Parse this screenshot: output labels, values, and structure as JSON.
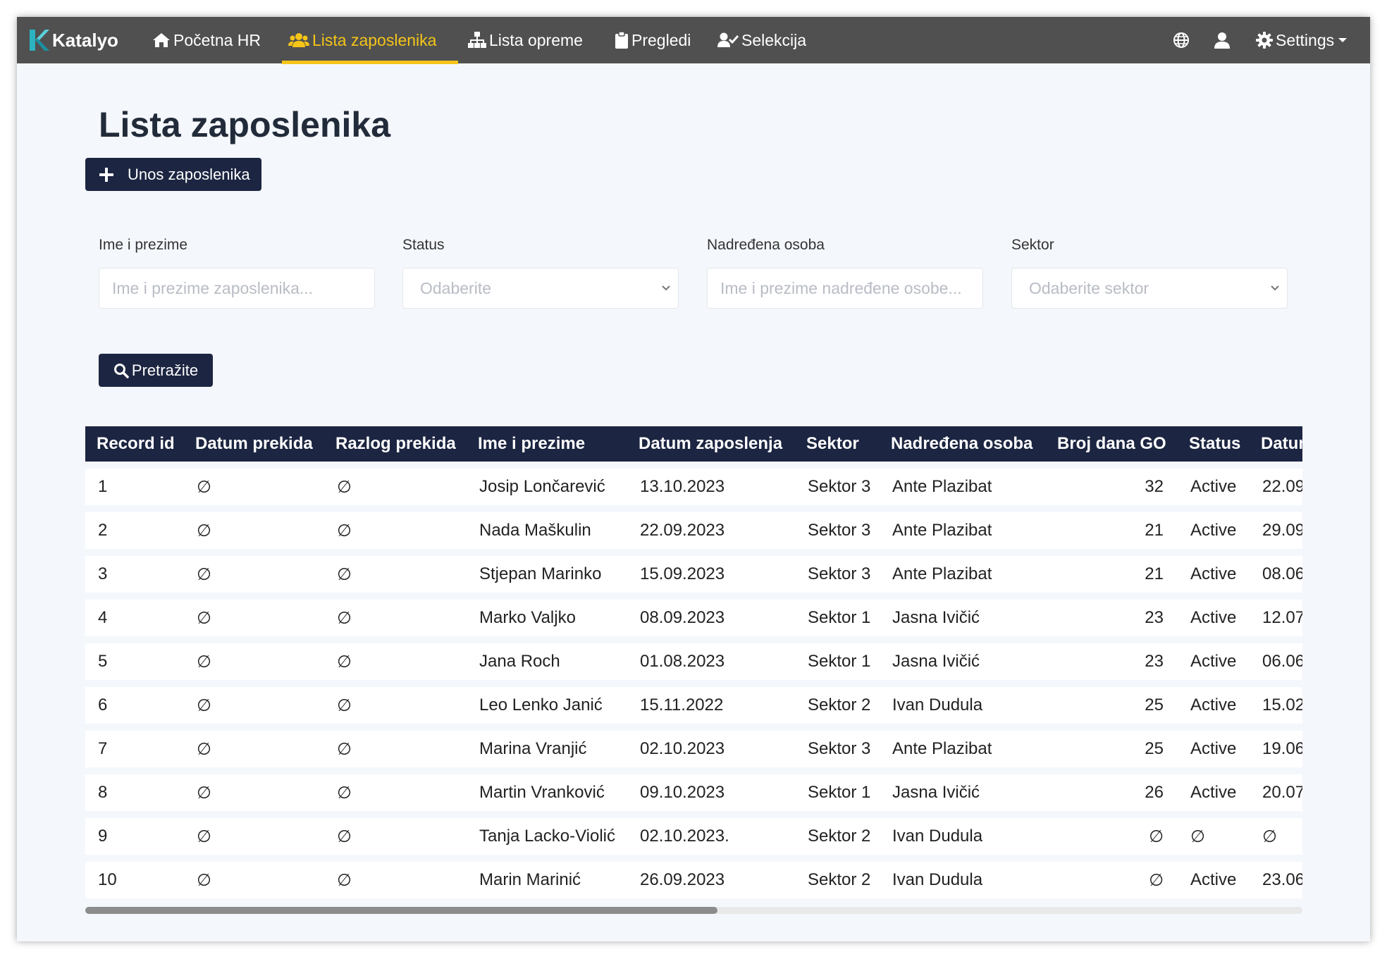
{
  "app": {
    "brand": "Katalyo"
  },
  "nav": {
    "items": [
      {
        "label": "Početna HR",
        "icon": "home-icon"
      },
      {
        "label": "Lista zaposlenika",
        "icon": "users-icon",
        "active": true
      },
      {
        "label": "Lista opreme",
        "icon": "sitemap-icon"
      },
      {
        "label": "Pregledi",
        "icon": "clipboard-icon"
      },
      {
        "label": "Selekcija",
        "icon": "user-check-icon"
      }
    ],
    "settings_label": "Settings",
    "right_icons": [
      "globe-icon",
      "user-icon",
      "gear-icon"
    ],
    "active_color": "#f5c518",
    "bar_color": "#505050"
  },
  "page": {
    "title": "Lista zaposlenika",
    "add_button": "Unos zaposlenika",
    "search_button": "Pretražite"
  },
  "filters": {
    "name_label": "Ime i prezime",
    "name_placeholder": "Ime i prezime zaposlenika...",
    "status_label": "Status",
    "status_value": "Odaberite",
    "manager_label": "Nadređena osoba",
    "manager_placeholder": "Ime i prezime nadređene osobe...",
    "sector_label": "Sektor",
    "sector_value": "Odaberite sektor"
  },
  "table": {
    "header_color": "#1c2541",
    "columns": [
      "Record id",
      "Datum prekida",
      "Razlog prekida",
      "Ime i prezime",
      "Datum zaposlenja",
      "Sektor",
      "Nadređena osoba",
      "Broj dana GO",
      "Status",
      "Datum"
    ],
    "rows": [
      [
        "1",
        "∅",
        "∅",
        "Josip Lončarević",
        "13.10.2023",
        "Sektor 3",
        "Ante Plazibat",
        "32",
        "Active",
        "22.09"
      ],
      [
        "2",
        "∅",
        "∅",
        "Nada Maškulin",
        "22.09.2023",
        "Sektor 3",
        "Ante Plazibat",
        "21",
        "Active",
        "29.09"
      ],
      [
        "3",
        "∅",
        "∅",
        "Stjepan Marinko",
        "15.09.2023",
        "Sektor 3",
        "Ante Plazibat",
        "21",
        "Active",
        "08.06"
      ],
      [
        "4",
        "∅",
        "∅",
        "Marko Valjko",
        "08.09.2023",
        "Sektor 1",
        "Jasna Ivičić",
        "23",
        "Active",
        "12.07"
      ],
      [
        "5",
        "∅",
        "∅",
        "Jana Roch",
        "01.08.2023",
        "Sektor 1",
        "Jasna Ivičić",
        "23",
        "Active",
        "06.06"
      ],
      [
        "6",
        "∅",
        "∅",
        "Leo Lenko Janić",
        "15.11.2022",
        "Sektor 2",
        "Ivan Dudula",
        "25",
        "Active",
        "15.02"
      ],
      [
        "7",
        "∅",
        "∅",
        "Marina Vranjić",
        "02.10.2023",
        "Sektor 3",
        "Ante Plazibat",
        "25",
        "Active",
        "19.06"
      ],
      [
        "8",
        "∅",
        "∅",
        "Martin Vranković",
        "09.10.2023",
        "Sektor 1",
        "Jasna Ivičić",
        "26",
        "Active",
        "20.07"
      ],
      [
        "9",
        "∅",
        "∅",
        "Tanja Lacko-Violić",
        "02.10.2023.",
        "Sektor 2",
        "Ivan Dudula",
        "∅",
        "∅",
        "∅"
      ],
      [
        "10",
        "∅",
        "∅",
        "Marin Marinić",
        "26.09.2023",
        "Sektor 2",
        "Ivan Dudula",
        "∅",
        "Active",
        "23.06"
      ]
    ]
  }
}
